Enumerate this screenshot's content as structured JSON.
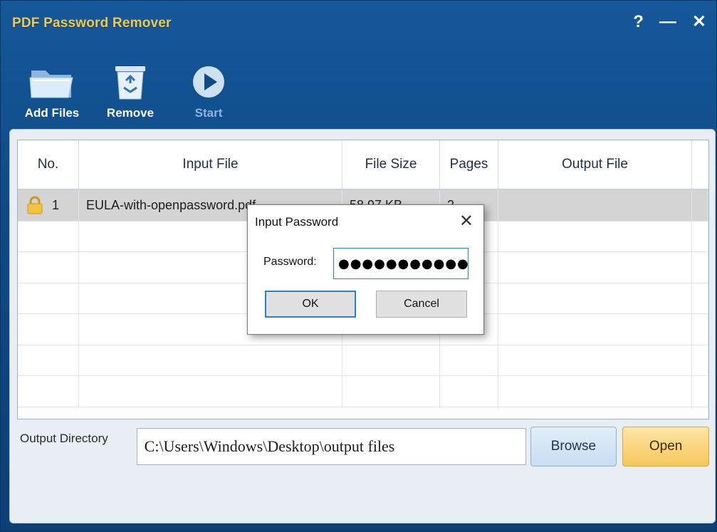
{
  "window": {
    "title": "PDF Password Remover",
    "help_label": "?",
    "minimize_label": "—",
    "close_label": "✕"
  },
  "toolbar": {
    "add_files_label": "Add Files",
    "remove_label": "Remove",
    "start_label": "Start"
  },
  "table": {
    "columns": [
      "No.",
      "Input File",
      "File Size",
      "Pages",
      "Output File"
    ],
    "rows": [
      {
        "no": "1",
        "input_file": "EULA-with-openpassword.pdf",
        "file_size": "58.97 KB",
        "pages": "2",
        "output_file": ""
      }
    ]
  },
  "output": {
    "label": "Output Directory",
    "path": "C:\\Users\\Windows\\Desktop\\output files",
    "browse_label": "Browse",
    "open_label": "Open"
  },
  "dialog": {
    "title": "Input Password",
    "close_label": "✕",
    "password_label": "Password:",
    "password_value": "●●●●●●●●●●●",
    "ok_label": "OK",
    "cancel_label": "Cancel"
  },
  "colors": {
    "titlebar_bg": "#16589a",
    "title_text": "#f2c84b",
    "selected_row": "#d4d4d4",
    "open_button": "#f6c65a",
    "browse_button": "#c7def2",
    "focus_blue": "#2f7fd1"
  },
  "icons": {
    "add_files": "folder-icon",
    "remove": "recycle-bin-icon",
    "start": "play-icon",
    "row_status": "lock-icon"
  }
}
